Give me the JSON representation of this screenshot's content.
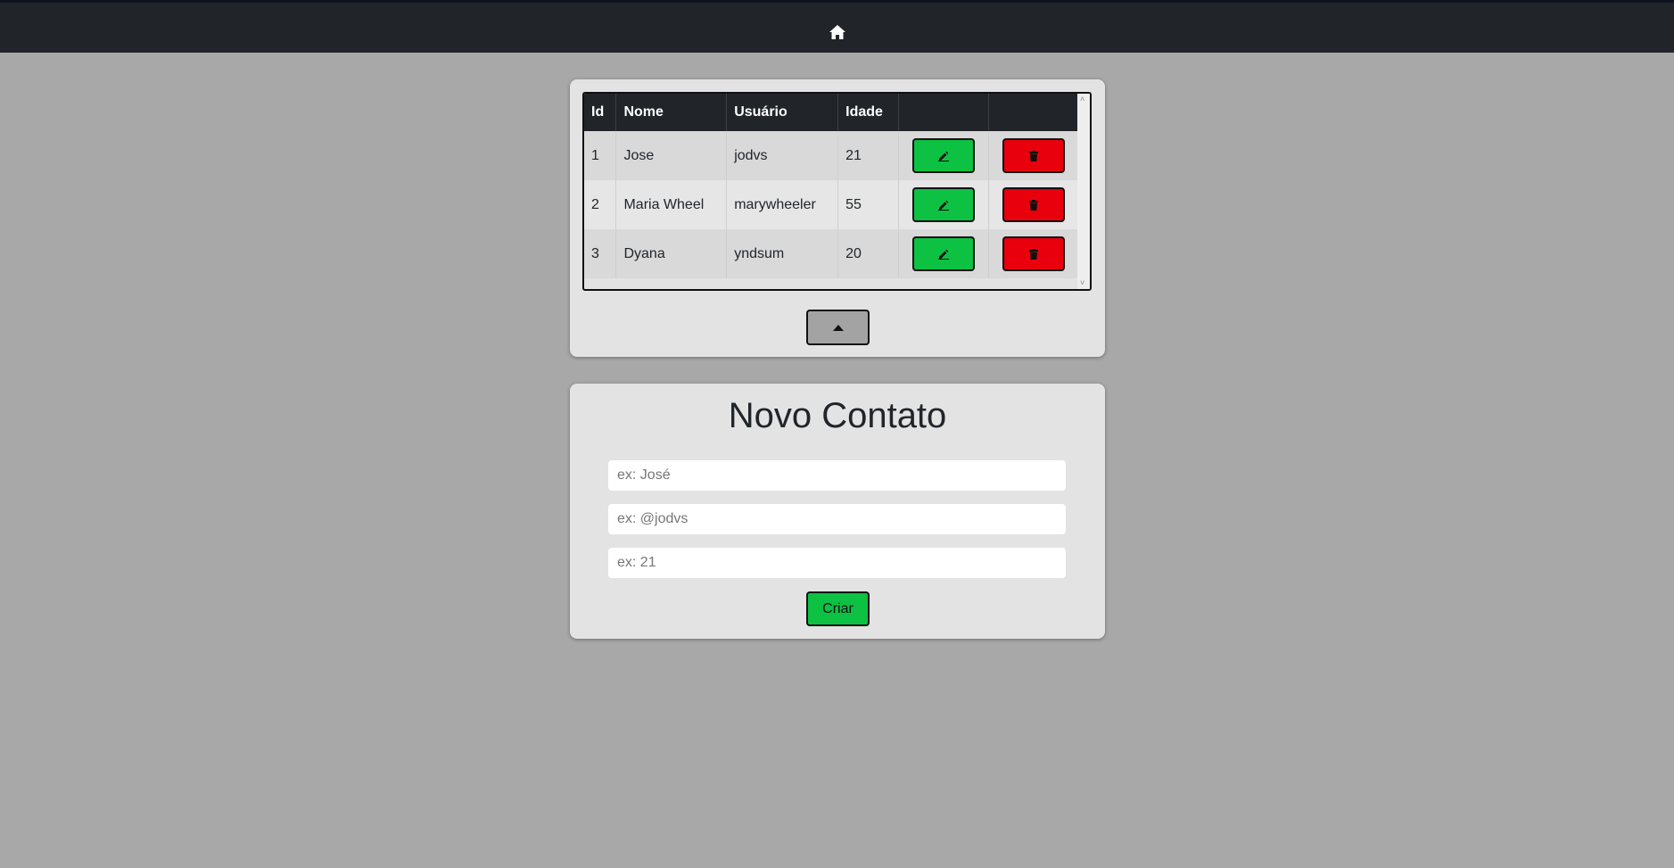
{
  "nav": {
    "home_icon": "home-icon"
  },
  "table": {
    "headers": [
      "Id",
      "Nome",
      "Usuário",
      "Idade",
      "",
      ""
    ],
    "rows": [
      {
        "id": "1",
        "nome": "Jose",
        "usuario": "jodvs",
        "idade": "21"
      },
      {
        "id": "2",
        "nome": "Maria Wheel",
        "usuario": "marywheeler",
        "idade": "55"
      },
      {
        "id": "3",
        "nome": "Dyana",
        "usuario": "yndsum",
        "idade": "20"
      }
    ],
    "edit_icon": "pencil-icon",
    "delete_icon": "trash-icon",
    "colors": {
      "edit": "#0dc143",
      "delete": "#e8000d",
      "header": "#212529"
    }
  },
  "collapse": {
    "icon": "caret-up-icon"
  },
  "form": {
    "title": "Novo Contato",
    "nome_placeholder": "ex: José",
    "usuario_placeholder": "ex: @jodvs",
    "idade_placeholder": "ex: 21",
    "nome_value": "",
    "usuario_value": "",
    "idade_value": "",
    "submit_label": "Criar"
  }
}
